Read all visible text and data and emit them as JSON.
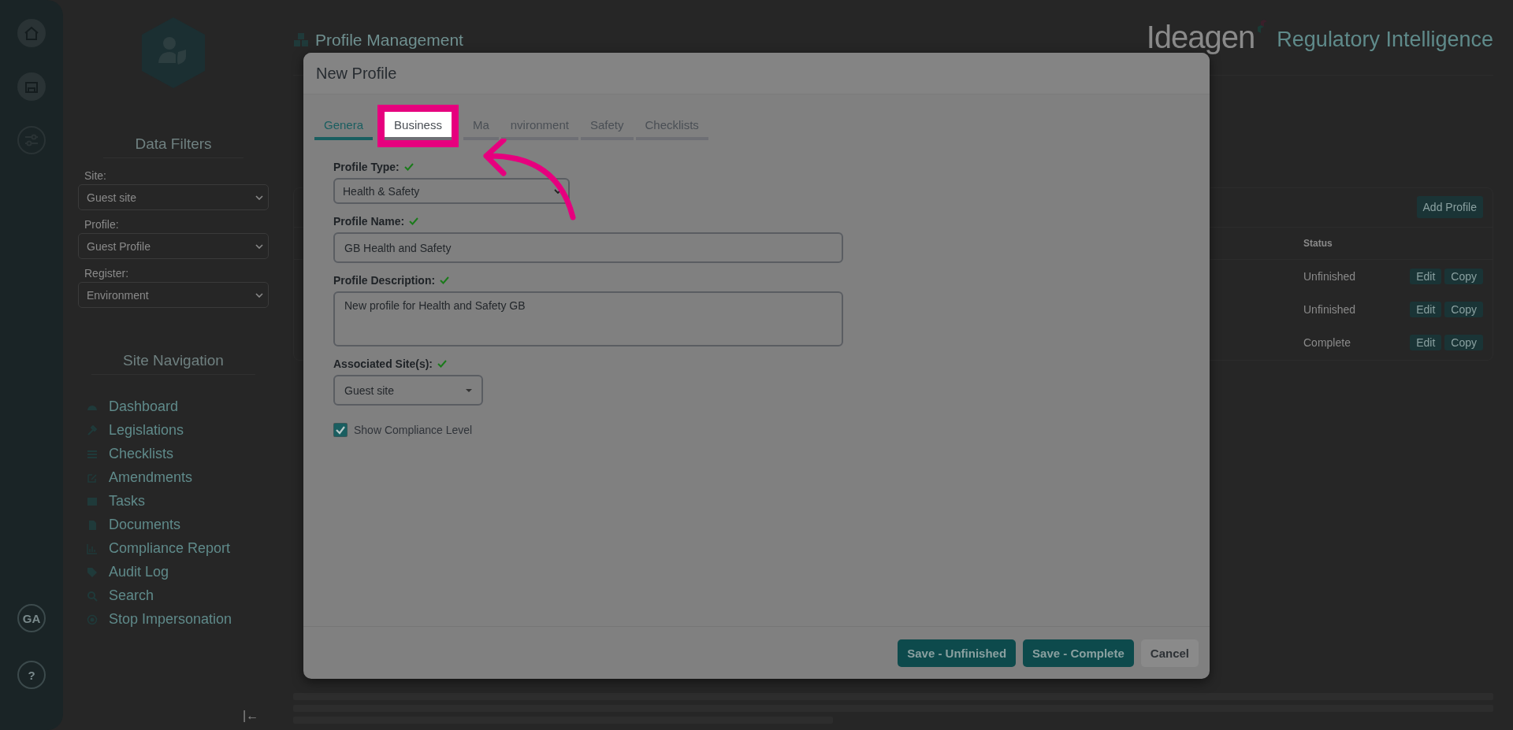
{
  "rail": {
    "avatar": "GA",
    "help": "?"
  },
  "sidebar": {
    "filters_title": "Data Filters",
    "filters": [
      {
        "label": "Site:",
        "value": "Guest site"
      },
      {
        "label": "Profile:",
        "value": "Guest Profile"
      },
      {
        "label": "Register:",
        "value": "Environment"
      }
    ],
    "nav_title": "Site Navigation",
    "nav_items": [
      {
        "label": "Dashboard",
        "kind": "gauge"
      },
      {
        "label": "Legislations",
        "kind": "gavel"
      },
      {
        "label": "Checklists",
        "kind": "list"
      },
      {
        "label": "Amendments",
        "kind": "edit"
      },
      {
        "label": "Tasks",
        "kind": "tasks"
      },
      {
        "label": "Documents",
        "kind": "file"
      },
      {
        "label": "Compliance Report",
        "kind": "chart"
      },
      {
        "label": "Audit Log",
        "kind": "tags"
      },
      {
        "label": "Search",
        "kind": "search"
      },
      {
        "label": "Stop Impersonation",
        "kind": "stop"
      }
    ],
    "collapse": "|←"
  },
  "header": {
    "page_title": "Profile Management",
    "logo_brand": "Ideagen",
    "logo_product": "Regulatory Intelligence"
  },
  "profiles_card": {
    "add_button": "Add Profile",
    "status_column": "Status",
    "rows": [
      {
        "status": "Unfinished",
        "edit": "Edit",
        "copy": "Copy"
      },
      {
        "status": "Unfinished",
        "edit": "Edit",
        "copy": "Copy"
      },
      {
        "status": "Complete",
        "edit": "Edit",
        "copy": "Copy"
      }
    ]
  },
  "modal": {
    "title": "New Profile",
    "tabs": [
      {
        "label": "Genera",
        "selected": true,
        "highlighted": false
      },
      {
        "label": "Business",
        "selected": false,
        "highlighted": true
      },
      {
        "label": "Ma",
        "selected": false,
        "highlighted": false
      },
      {
        "label": "nvironment",
        "selected": false,
        "highlighted": false
      },
      {
        "label": "Safety",
        "selected": false,
        "highlighted": false
      },
      {
        "label": "Checklists",
        "selected": false,
        "highlighted": false
      }
    ],
    "fields": [
      {
        "kind": "select",
        "label": "Profile Type:",
        "valid": true,
        "value": "Health & Safety"
      },
      {
        "kind": "text",
        "label": "Profile Name:",
        "valid": true,
        "value": "GB Health and Safety"
      },
      {
        "kind": "textarea",
        "label": "Profile Description:",
        "valid": true,
        "value": "New profile for Health and Safety GB"
      },
      {
        "kind": "dropdown",
        "label": "Associated Site(s):",
        "valid": true,
        "value": "Guest site"
      }
    ],
    "checkbox": {
      "label": "Show Compliance Level",
      "checked": true
    },
    "buttons": [
      {
        "label": "Save - Unfinished",
        "kind": "primary"
      },
      {
        "label": "Save - Complete",
        "kind": "primary"
      },
      {
        "label": "Cancel",
        "kind": "secondary"
      }
    ]
  }
}
